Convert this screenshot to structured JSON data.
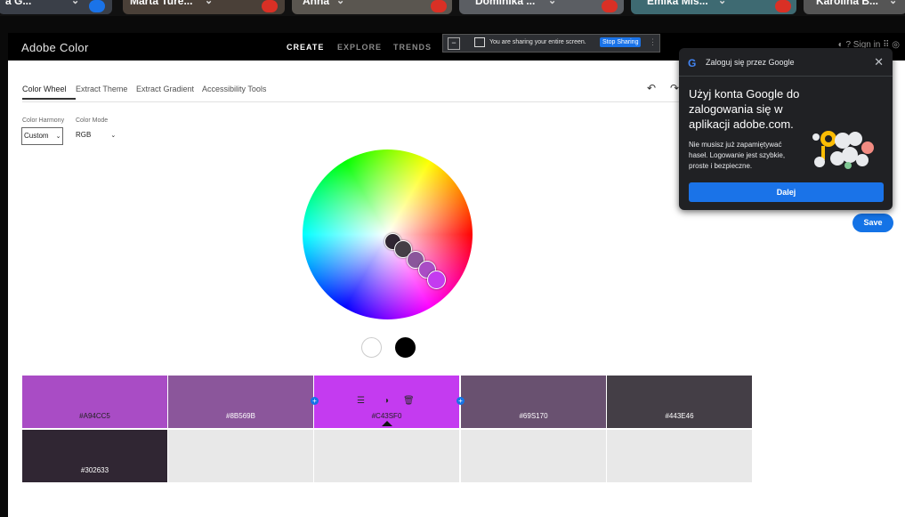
{
  "participants": [
    {
      "name": "a G...",
      "mic": "on"
    },
    {
      "name": "Marta Ture...",
      "mic": "muted"
    },
    {
      "name": "Anna",
      "mic": "muted"
    },
    {
      "name": "Dominika ...",
      "mic": "muted"
    },
    {
      "name": "Emika Mis...",
      "mic": "muted"
    },
    {
      "name": "Karolina B...",
      "mic": "muted"
    }
  ],
  "app": {
    "brand": "Adobe Color",
    "nav": [
      "CREATE",
      "EXPLORE",
      "TRENDS"
    ],
    "sign_in": "Sign in"
  },
  "share_bar": {
    "message": "You are sharing your entire screen.",
    "stop_label": "Stop Sharing"
  },
  "tabs": [
    "Color Wheel",
    "Extract Theme",
    "Extract Gradient",
    "Accessibility Tools"
  ],
  "controls": {
    "harmony_label": "Color Harmony",
    "harmony_value": "Custom",
    "mode_label": "Color Mode",
    "mode_value": "RGB"
  },
  "palette": [
    {
      "hex": "#A94CC5",
      "color": "#a94cc5"
    },
    {
      "hex": "#8B569B",
      "color": "#8b569b"
    },
    {
      "hex": "#C43SF0",
      "color": "#c43bf0"
    },
    {
      "hex": "#69S170",
      "color": "#695170"
    },
    {
      "hex": "#443E46",
      "color": "#443e46"
    },
    {
      "hex": "#302633",
      "color": "#302633"
    }
  ],
  "save_label": "Save",
  "google": {
    "header": "Zaloguj się przez Google",
    "title": "Użyj konta Google do zalogowania się w aplikacji adobe.com.",
    "body": "Nie musisz już zapamiętywać haseł. Logowanie jest szybkie, proste i bezpieczne.",
    "button": "Dalej"
  },
  "colors": {
    "accent": "#1473e6",
    "google_blue": "#1a73e8",
    "panel_bg": "#202124"
  }
}
